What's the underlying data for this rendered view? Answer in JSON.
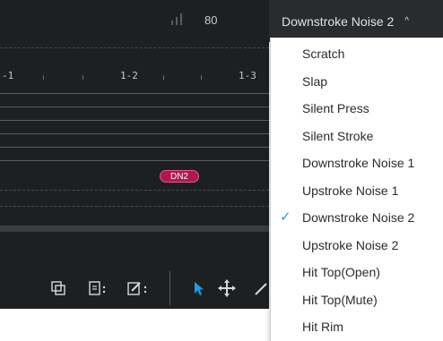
{
  "header": {
    "tempo": "80",
    "selected_label": "Downstroke Noise 2",
    "chevron_glyph": "^"
  },
  "ruler": {
    "labels": [
      "-1",
      "1-2",
      "1-3"
    ]
  },
  "track": {
    "note_label": "DN2",
    "note_color": "#b0174f"
  },
  "toolbar": {
    "icons": [
      "copy-icon",
      "list-menu-icon",
      "edit-menu-icon",
      "select-arrow-icon",
      "move-icon",
      "pencil-icon"
    ],
    "accent": "#1a9cf0"
  },
  "menu": {
    "items": [
      {
        "label": "Scratch",
        "checked": false
      },
      {
        "label": "Slap",
        "checked": false
      },
      {
        "label": "Silent Press",
        "checked": false
      },
      {
        "label": "Silent Stroke",
        "checked": false
      },
      {
        "label": "Downstroke Noise 1",
        "checked": false
      },
      {
        "label": "Upstroke Noise 1",
        "checked": false
      },
      {
        "label": "Downstroke Noise 2",
        "checked": true
      },
      {
        "label": "Upstroke Noise 2",
        "checked": false
      },
      {
        "label": "Hit Top(Open)",
        "checked": false
      },
      {
        "label": "Hit Top(Mute)",
        "checked": false
      },
      {
        "label": "Hit Rim",
        "checked": false
      }
    ],
    "check_glyph": "✓"
  }
}
